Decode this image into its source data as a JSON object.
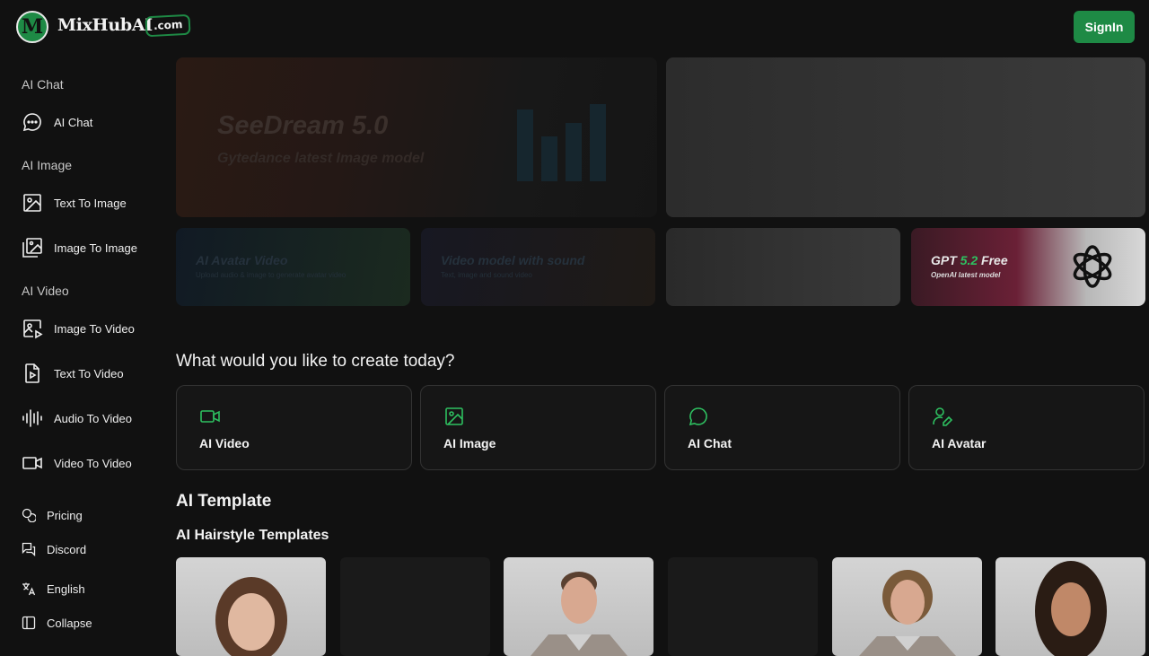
{
  "brand": {
    "logo_letter": "M",
    "name": "MixHubAI",
    "badge": ".com"
  },
  "header": {
    "signin_label": "SignIn"
  },
  "colors": {
    "accent": "#1e8a45",
    "icon_green": "#2ec060",
    "background": "#111111"
  },
  "sidebar": {
    "sections": [
      {
        "title": "AI Chat",
        "items": [
          {
            "label": "AI Chat",
            "icon": "chat-icon"
          }
        ]
      },
      {
        "title": "AI Image",
        "items": [
          {
            "label": "Text To Image",
            "icon": "image-icon"
          },
          {
            "label": "Image To Image",
            "icon": "images-icon"
          }
        ]
      },
      {
        "title": "AI Video",
        "items": [
          {
            "label": "Image To Video",
            "icon": "image-play-icon"
          },
          {
            "label": "Text To Video",
            "icon": "file-play-icon"
          },
          {
            "label": "Audio To Video",
            "icon": "audio-wave-icon"
          },
          {
            "label": "Video To Video",
            "icon": "video-camera-icon"
          }
        ]
      }
    ],
    "bottom": [
      {
        "label": "Pricing",
        "icon": "coins-icon"
      },
      {
        "label": "Discord",
        "icon": "message-square-icon"
      },
      {
        "label": "English",
        "icon": "language-icon"
      },
      {
        "label": "Collapse",
        "icon": "sidebar-collapse-icon"
      }
    ]
  },
  "banners": {
    "main": {
      "title": "SeeDream 5.0",
      "subtitle": "Gytedance latest Image model"
    },
    "tiles": [
      {
        "title": "AI Avatar Video",
        "subtitle": "Upload audio & image to generate avatar video"
      },
      {
        "title": "Video model with sound",
        "subtitle": "Text, image and sound video"
      },
      {
        "title": "",
        "subtitle": ""
      },
      {
        "title_prefix": "GPT ",
        "title_highlight": "5.2",
        "title_suffix": " Free",
        "subtitle": "OpenAI latest model"
      }
    ]
  },
  "create": {
    "heading": "What would you like to create today?",
    "cards": [
      {
        "label": "AI Video",
        "icon": "video-camera-icon"
      },
      {
        "label": "AI Image",
        "icon": "image-icon"
      },
      {
        "label": "AI Chat",
        "icon": "chat-icon"
      },
      {
        "label": "AI Avatar",
        "icon": "user-edit-icon"
      }
    ]
  },
  "templates": {
    "heading": "AI Template",
    "subheading": "AI Hairstyle Templates"
  }
}
